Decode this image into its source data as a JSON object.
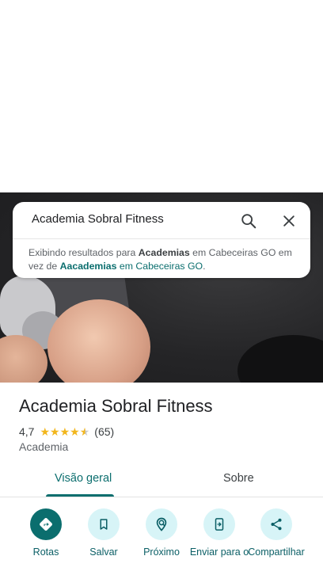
{
  "search": {
    "query": "Academia Sobral Fitness",
    "notice_prefix": "Exibindo resultados para ",
    "notice_bold": "Academias",
    "notice_mid": " em Cabeceiras GO",
    "notice_after": " em vez de ",
    "notice_original": "Aacademias",
    "notice_suffix": " em Cabeceiras GO",
    "notice_end": "."
  },
  "place": {
    "name": "Academia Sobral Fitness",
    "rating": "4,7",
    "rating_value": 4.7,
    "review_count": "(65)",
    "category": "Academia"
  },
  "tabs": [
    {
      "label": "Visão geral",
      "active": true
    },
    {
      "label": "Sobre",
      "active": false
    }
  ],
  "actions": [
    {
      "label": "Rotas",
      "icon": "directions-icon"
    },
    {
      "label": "Salvar",
      "icon": "bookmark-icon"
    },
    {
      "label": "Próximo",
      "icon": "nearby-icon"
    },
    {
      "label": "Enviar para o",
      "icon": "send-to-phone-icon"
    },
    {
      "label": "Compartilhar",
      "icon": "share-icon"
    }
  ],
  "colors": {
    "accent": "#0b6e6e",
    "action_bg": "#d7f4f7",
    "star": "#f2b61c"
  }
}
